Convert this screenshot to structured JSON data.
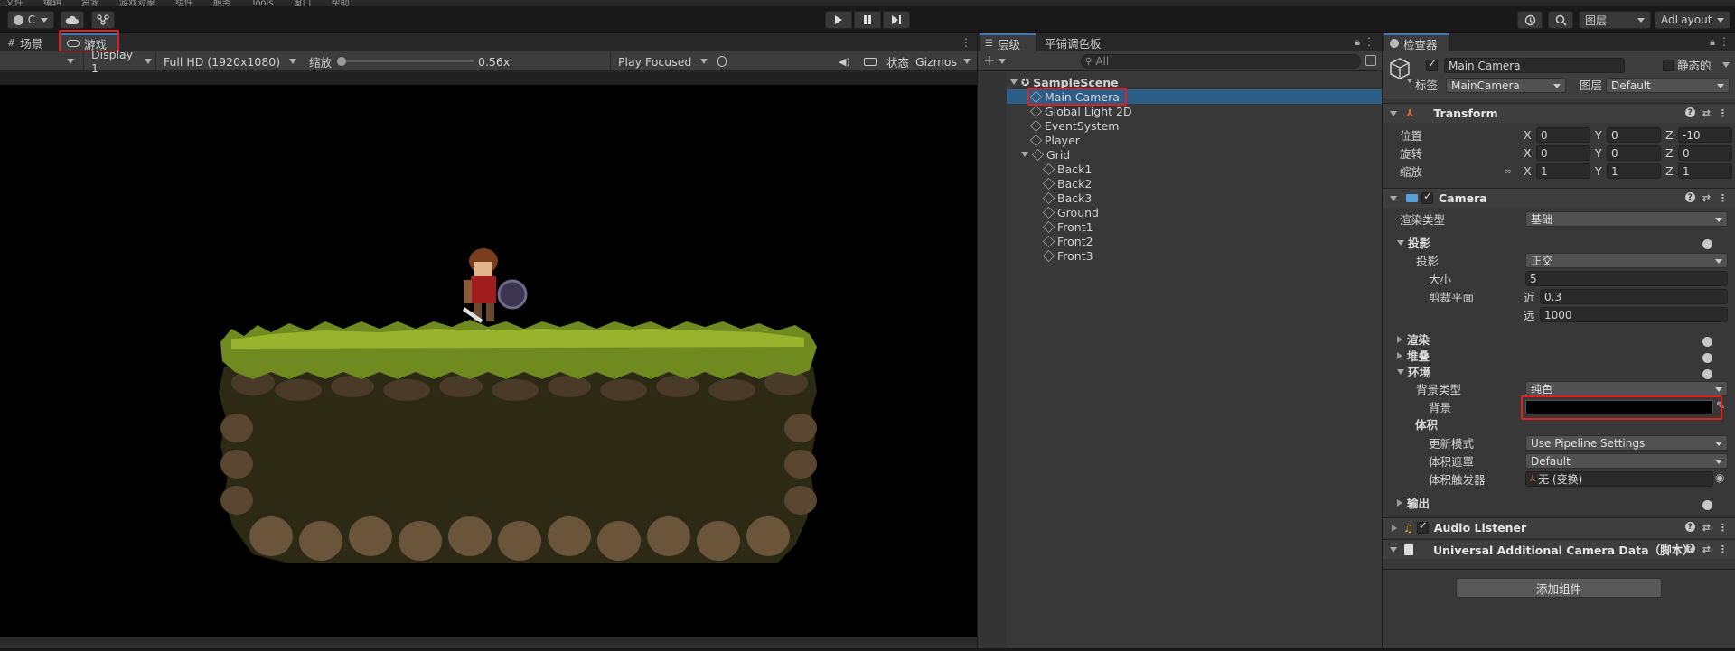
{
  "menubar": {
    "items": [
      "文件",
      "编辑",
      "资源",
      "游戏对象",
      "组件",
      "服务",
      "Tools",
      "窗口",
      "帮助"
    ]
  },
  "toolbar": {
    "account_label": "C",
    "layers_label": "图层",
    "layout_label": "AdLayout"
  },
  "left_panel": {
    "tabs": [
      {
        "label": "场景"
      },
      {
        "label": "游戏"
      }
    ],
    "display": "Display 1",
    "resolution": "Full HD (1920x1080)",
    "scale_label": "缩放",
    "scale_value": "0.56x",
    "play_mode": "Play Focused",
    "stats_label": "状态",
    "gizmos_label": "Gizmos"
  },
  "hierarchy": {
    "tabs": [
      {
        "label": "层级"
      },
      {
        "label": "平铺调色板"
      }
    ],
    "search_placeholder": "All",
    "scene": "SampleScene",
    "items": [
      {
        "label": "Main Camera"
      },
      {
        "label": "Global Light 2D"
      },
      {
        "label": "EventSystem"
      },
      {
        "label": "Player"
      },
      {
        "label": "Grid"
      }
    ],
    "grid_children": [
      {
        "label": "Back1"
      },
      {
        "label": "Back2"
      },
      {
        "label": "Back3"
      },
      {
        "label": "Ground"
      },
      {
        "label": "Front1"
      },
      {
        "label": "Front2"
      },
      {
        "label": "Front3"
      }
    ]
  },
  "inspector": {
    "tab_label": "检查器",
    "object_name": "Main Camera",
    "static_label": "静态的",
    "tag_label": "标签",
    "tag_value": "MainCamera",
    "layer_label": "图层",
    "layer_value": "Default",
    "transform": {
      "title": "Transform",
      "position_label": "位置",
      "rotation_label": "旋转",
      "scale_label": "缩放",
      "x": "X",
      "y": "Y",
      "z": "Z",
      "position": [
        "0",
        "0",
        "-10"
      ],
      "rotation": [
        "0",
        "0",
        "0"
      ],
      "scale": [
        "1",
        "1",
        "1"
      ]
    },
    "camera": {
      "title": "Camera",
      "render_type_label": "渲染类型",
      "render_type_value": "基础",
      "projection_header": "投影",
      "projection_label": "投影",
      "projection_value": "正交",
      "size_label": "大小",
      "size_value": "5",
      "clipping_label": "剪裁平面",
      "near_label": "近",
      "near_value": "0.3",
      "far_label": "远",
      "far_value": "1000",
      "render_header": "渲染",
      "stack_header": "堆叠",
      "environment_header": "环境",
      "bg_type_label": "背景类型",
      "bg_type_value": "纯色",
      "bg_label": "背景",
      "bg_color": "#000000",
      "volume_header": "体积",
      "update_mode_label": "更新模式",
      "update_mode_value": "Use Pipeline Settings",
      "volume_mask_label": "体积遮罩",
      "volume_mask_value": "Default",
      "volume_trigger_label": "体积触发器",
      "volume_trigger_value": "无 (变换)",
      "output_header": "输出"
    },
    "audio_listener": {
      "title": "Audio Listener"
    },
    "urp_data": {
      "title": "Universal Additional Camera Data（脚本）"
    },
    "add_component_label": "添加组件"
  },
  "colors": {
    "highlight": "#e0201f",
    "selection": "#2c5d87",
    "accent": "#3a79bb"
  }
}
